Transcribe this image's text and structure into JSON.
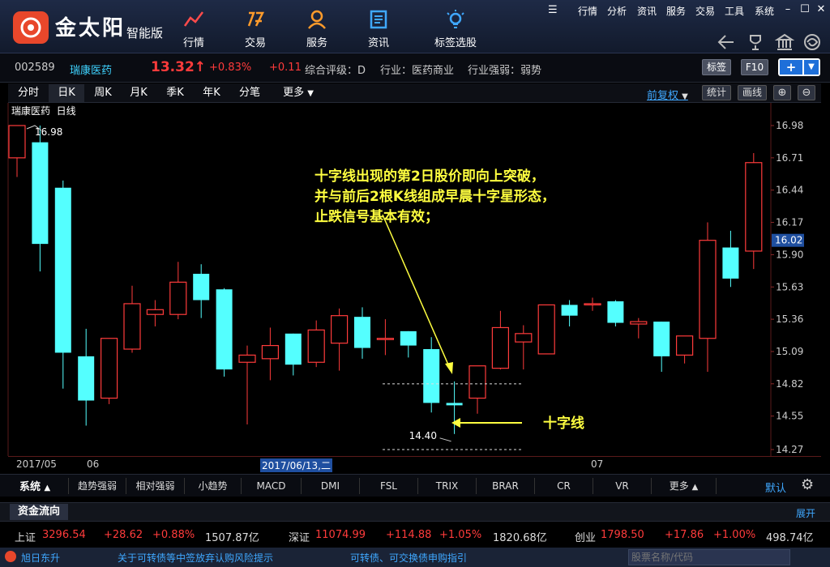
{
  "app": {
    "brand": "金太阳",
    "edition": "智能版"
  },
  "nav": [
    {
      "label": "行情",
      "icon": "trend-line-icon"
    },
    {
      "label": "交易",
      "icon": "trade-icon"
    },
    {
      "label": "服务",
      "icon": "person-icon"
    },
    {
      "label": "资讯",
      "icon": "news-icon"
    },
    {
      "label": "标签选股",
      "icon": "bulb-icon"
    }
  ],
  "sys_menu": [
    "行情",
    "分析",
    "资讯",
    "服务",
    "交易",
    "工具",
    "系统"
  ],
  "stock": {
    "code": "002589",
    "name": "瑞康医药",
    "price": "13.32",
    "arrow": "↑",
    "change_pct": "+0.83%",
    "change": "+0.11",
    "rating": "综合评级：D",
    "industry": "行业：医药商业",
    "industry_strength": "行业强弱：弱势",
    "btn_tag": "标签",
    "btn_f10": "F10"
  },
  "period_tabs": [
    "分时",
    "日K",
    "周K",
    "月K",
    "季K",
    "年K",
    "分笔",
    "更多"
  ],
  "period_active": "日K",
  "right_controls": {
    "adjust": "前复权",
    "stats": "统计",
    "draw": "画线"
  },
  "chart_header": {
    "name": "瑞康医药",
    "period": "日线"
  },
  "annotation": {
    "lines": [
      "十字线出现的第2日股价即向上突破，",
      "并与前后2根K线组成早晨十字星形态，",
      "止跌信号基本有效；"
    ],
    "cross_label": "十字线",
    "high_label": "16.98",
    "low_label": "14.40"
  },
  "colors": {
    "up": "#ff3b3b",
    "down": "#54ffff",
    "annotation": "#ffff40",
    "axis_highlight": "#1f4fa0"
  },
  "chart_data": {
    "type": "candlestick",
    "y_ticks": [
      "16.98",
      "16.71",
      "16.44",
      "16.17",
      "16.02",
      "15.90",
      "15.63",
      "15.36",
      "15.09",
      "14.82",
      "14.55",
      "14.27"
    ],
    "current_price": 16.02,
    "ylim": [
      14.27,
      16.98
    ],
    "candles": [
      {
        "o": 16.71,
        "c": 16.98,
        "h": 16.98,
        "l": 16.55
      },
      {
        "o": 16.84,
        "c": 15.99,
        "h": 16.98,
        "l": 15.76
      },
      {
        "o": 16.46,
        "c": 15.08,
        "h": 16.52,
        "l": 14.78
      },
      {
        "o": 15.05,
        "c": 14.68,
        "h": 15.28,
        "l": 14.47
      },
      {
        "o": 14.7,
        "c": 15.2,
        "h": 15.2,
        "l": 14.65
      },
      {
        "o": 15.11,
        "c": 15.49,
        "h": 15.64,
        "l": 15.08
      },
      {
        "o": 15.4,
        "c": 15.44,
        "h": 15.52,
        "l": 15.3
      },
      {
        "o": 15.4,
        "c": 15.67,
        "h": 15.84,
        "l": 15.36
      },
      {
        "o": 15.74,
        "c": 15.52,
        "h": 15.82,
        "l": 15.37
      },
      {
        "o": 15.61,
        "c": 14.94,
        "h": 15.62,
        "l": 14.88
      },
      {
        "o": 15.0,
        "c": 15.06,
        "h": 15.14,
        "l": 14.48
      },
      {
        "o": 15.03,
        "c": 15.14,
        "h": 15.29,
        "l": 14.85
      },
      {
        "o": 15.24,
        "c": 14.98,
        "h": 15.24,
        "l": 14.89
      },
      {
        "o": 15.0,
        "c": 15.27,
        "h": 15.35,
        "l": 14.96
      },
      {
        "o": 15.16,
        "c": 15.39,
        "h": 15.45,
        "l": 14.93
      },
      {
        "o": 15.38,
        "c": 15.12,
        "h": 15.46,
        "l": 15.03
      },
      {
        "o": 15.19,
        "c": 15.2,
        "h": 15.36,
        "l": 15.06
      },
      {
        "o": 15.26,
        "c": 15.14,
        "h": 15.26,
        "l": 15.04
      },
      {
        "o": 15.11,
        "c": 14.66,
        "h": 15.21,
        "l": 14.58
      },
      {
        "o": 14.66,
        "c": 14.64,
        "h": 14.84,
        "l": 14.4
      },
      {
        "o": 14.7,
        "c": 14.97,
        "h": 14.97,
        "l": 14.57
      },
      {
        "o": 14.95,
        "c": 15.29,
        "h": 15.43,
        "l": 14.94
      },
      {
        "o": 15.17,
        "c": 15.24,
        "h": 15.31,
        "l": 14.94
      },
      {
        "o": 15.07,
        "c": 15.48,
        "h": 15.48,
        "l": 15.07
      },
      {
        "o": 15.48,
        "c": 15.39,
        "h": 15.52,
        "l": 15.3
      },
      {
        "o": 15.48,
        "c": 15.49,
        "h": 15.54,
        "l": 15.43
      },
      {
        "o": 15.51,
        "c": 15.33,
        "h": 15.52,
        "l": 15.3
      },
      {
        "o": 15.32,
        "c": 15.34,
        "h": 15.37,
        "l": 15.2
      },
      {
        "o": 15.34,
        "c": 15.05,
        "h": 15.34,
        "l": 14.92
      },
      {
        "o": 15.06,
        "c": 15.22,
        "h": 15.22,
        "l": 14.99
      },
      {
        "o": 15.2,
        "c": 16.02,
        "h": 16.17,
        "l": 14.92
      },
      {
        "o": 15.96,
        "c": 15.7,
        "h": 16.1,
        "l": 15.63
      },
      {
        "o": 15.93,
        "c": 16.67,
        "h": 16.75,
        "l": 15.78
      }
    ],
    "x_labels": [
      "2017/05",
      "06",
      "2017/06/13,二",
      "07"
    ]
  },
  "indicator_tabs": [
    "趋势强弱",
    "相对强弱",
    "小趋势",
    "MACD",
    "DMI",
    "FSL",
    "TRIX",
    "BRAR",
    "CR",
    "VR",
    "更多"
  ],
  "indicator_system": "系统",
  "indicator_default": "默认",
  "fund": {
    "title": "资金流向",
    "expand": "展开"
  },
  "indices": [
    {
      "name": "上证",
      "value": "3296.54",
      "change": "+28.62",
      "pct": "+0.88%",
      "amount": "1507.87亿"
    },
    {
      "name": "深证",
      "value": "11074.99",
      "change": "+114.88",
      "pct": "+1.05%",
      "amount": "1820.68亿"
    },
    {
      "name": "创业",
      "value": "1798.50",
      "change": "+17.86",
      "pct": "+1.00%",
      "amount": "498.74亿"
    }
  ],
  "status": {
    "broker": "旭日东升",
    "notice1": "关于可转债等中签放弃认购风险提示",
    "notice2": "可转债、可交换债申购指引",
    "search_placeholder": "股票名称/代码"
  }
}
